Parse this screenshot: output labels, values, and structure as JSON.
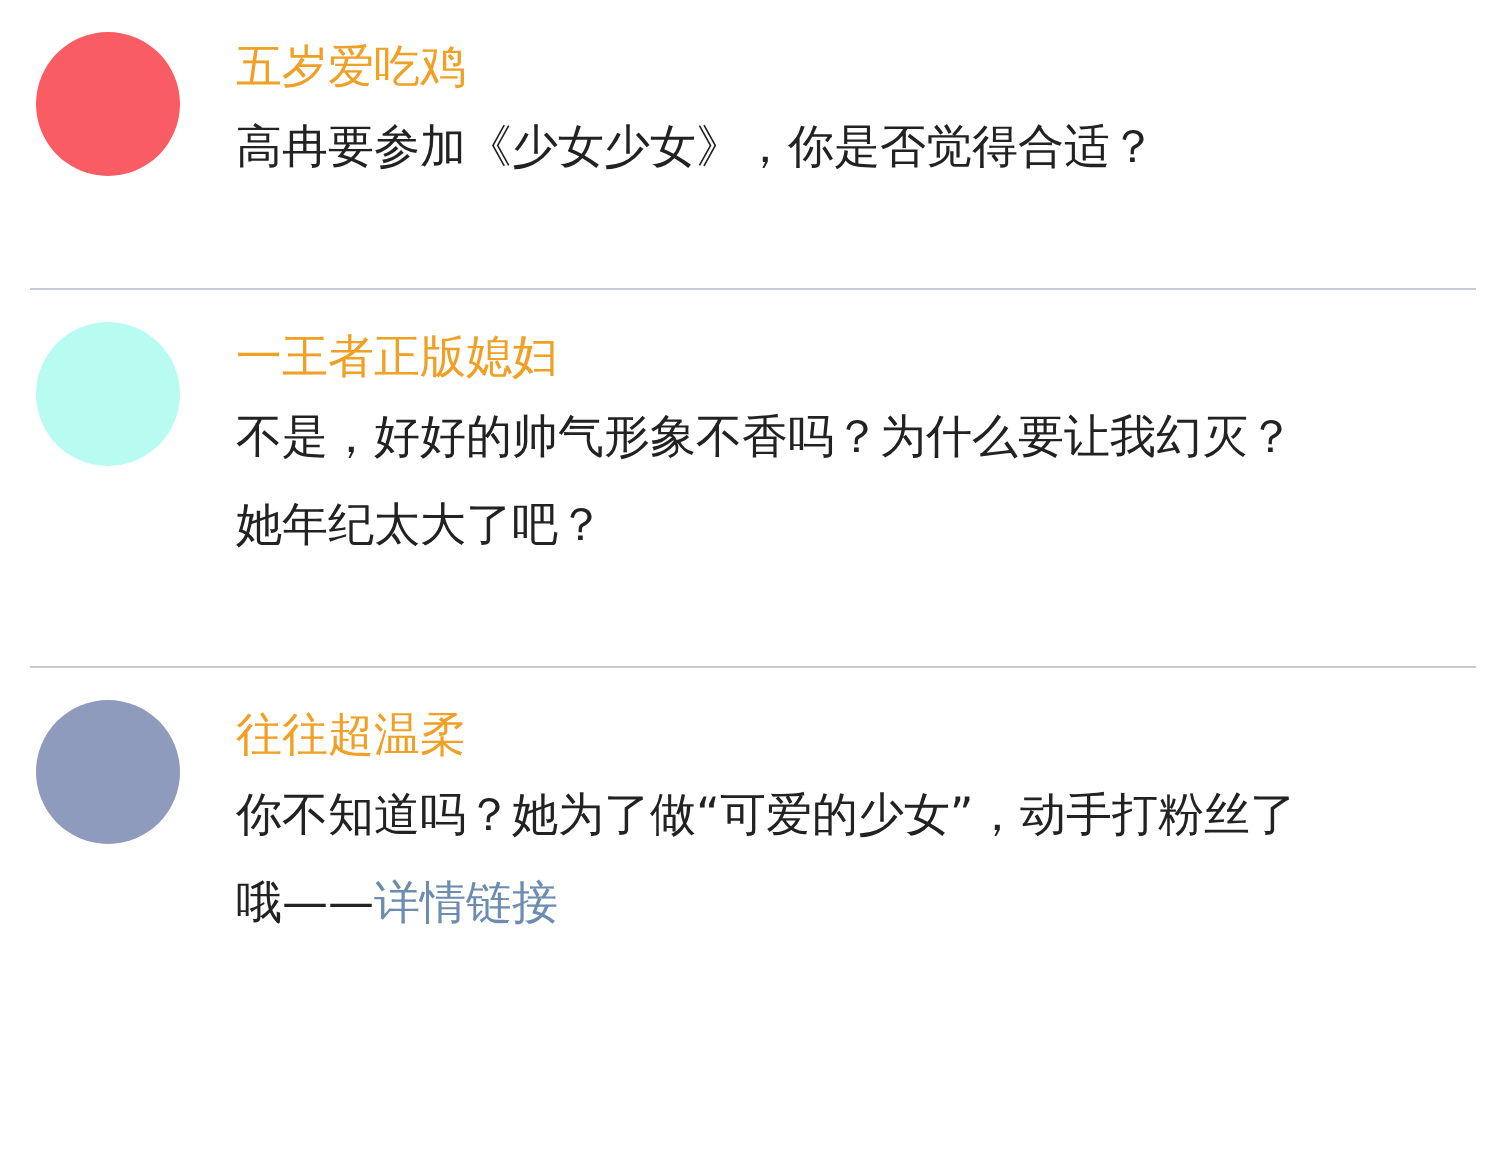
{
  "comments": [
    {
      "name": "五岁爱吃鸡",
      "color": "#f95c62",
      "lines": [
        "高冉要参加《少女少女》，你是否觉得合适？"
      ]
    },
    {
      "name": "一王者正版媳妇",
      "color": "#b8fbf0",
      "lines": [
        "不是，好好的帅气形象不香吗？为什么要让我幻灭？",
        "她年纪太大了吧？"
      ]
    },
    {
      "name": "往往超温柔",
      "color": "#8f9bbd",
      "lines": [
        "你不知道吗？她为了做“可爱的少女”，动手打粉丝了",
        "哦——"
      ],
      "link": "详情链接"
    }
  ]
}
